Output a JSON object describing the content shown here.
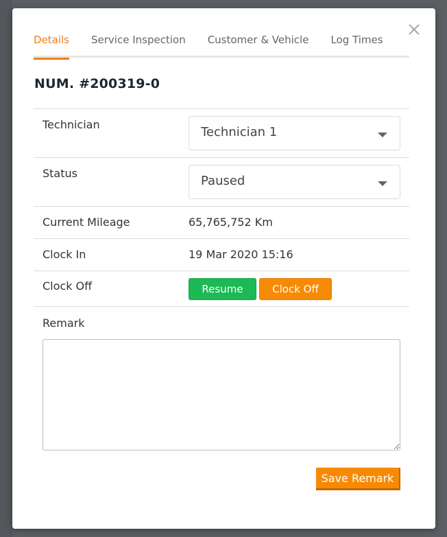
{
  "tabs": [
    {
      "label": "Details",
      "active": true
    },
    {
      "label": "Service Inspection",
      "active": false
    },
    {
      "label": "Customer & Vehicle",
      "active": false
    },
    {
      "label": "Log Times",
      "active": false
    }
  ],
  "title": "NUM. #200319-0",
  "fields": {
    "technician": {
      "label": "Technician",
      "value": "Technician 1"
    },
    "status": {
      "label": "Status",
      "value": "Paused"
    },
    "mileage": {
      "label": "Current Mileage",
      "value": "65,765,752 Km"
    },
    "clock_in": {
      "label": "Clock In",
      "value": "19 Mar 2020 15:16"
    },
    "clock_off": {
      "label": "Clock Off",
      "resume_label": "Resume",
      "clock_off_label": "Clock Off"
    }
  },
  "remark": {
    "label": "Remark",
    "value": "",
    "save_label": "Save Remark"
  },
  "icons": {
    "close": "close-icon",
    "caret": "chevron-down-icon"
  },
  "colors": {
    "accent": "#f07e1a",
    "resume": "#1db954",
    "clock_off": "#f78a05"
  }
}
